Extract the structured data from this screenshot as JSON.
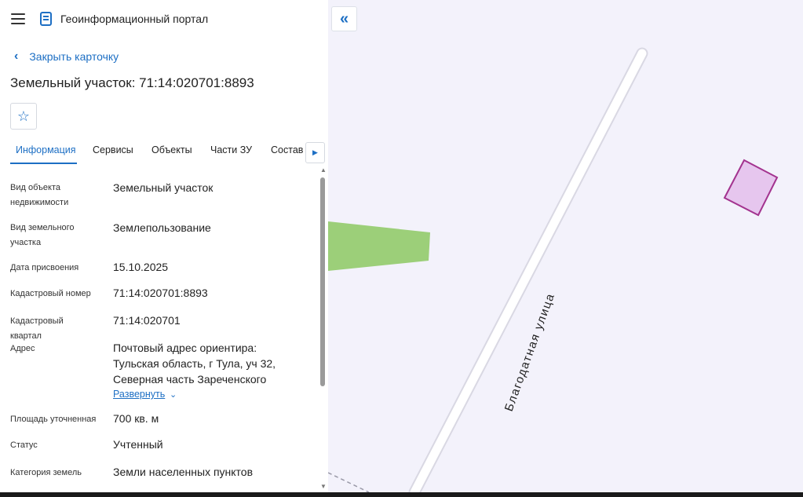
{
  "app": {
    "title": "Геоинформационный портал"
  },
  "card": {
    "back_label": "Закрыть карточку",
    "title": "Земельный участок: 71:14:020701:8893"
  },
  "tabs": [
    {
      "label": "Информация",
      "active": true
    },
    {
      "label": "Сервисы",
      "active": false
    },
    {
      "label": "Объекты",
      "active": false
    },
    {
      "label": "Части ЗУ",
      "active": false
    },
    {
      "label": "Состав",
      "active": false
    }
  ],
  "info": {
    "rows": [
      {
        "label": "Вид объекта недвижимости",
        "value": "Земельный участок"
      },
      {
        "label": "Вид земельного участка",
        "value": "Землепользование"
      },
      {
        "label": "Дата присвоения",
        "value": "15.10.2025"
      },
      {
        "label": "Кадастровый номер",
        "value": "71:14:020701:8893"
      },
      {
        "label": "Кадастровый квартал",
        "value": "71:14:020701"
      },
      {
        "label": "Адрес",
        "value": "Почтовый адрес ориентира: Тульская область, г Тула, уч 32, Северная часть Зареченского"
      },
      {
        "label": "Площадь уточненная",
        "value": "700 кв. м"
      },
      {
        "label": "Статус",
        "value": "Учтенный"
      },
      {
        "label": "Категория земель",
        "value": "Земли населенных пунктов"
      }
    ],
    "expand_label": "Развернуть"
  },
  "map": {
    "street_label": "Благодатная улица",
    "colors": {
      "background": "#f3f2fb",
      "parcel_fill": "#e6c6ee",
      "parcel_stroke": "#a3338f",
      "green_area": "#9ccf79"
    }
  },
  "icons": {
    "menu": "hamburger-icon",
    "logo": "portal-logo-icon",
    "back": "chevron-left-icon",
    "favorite": "star-icon",
    "collapse": "double-chevron-left-icon",
    "tab_scroll": "caret-right-icon",
    "expand": "chevron-down-icon"
  }
}
